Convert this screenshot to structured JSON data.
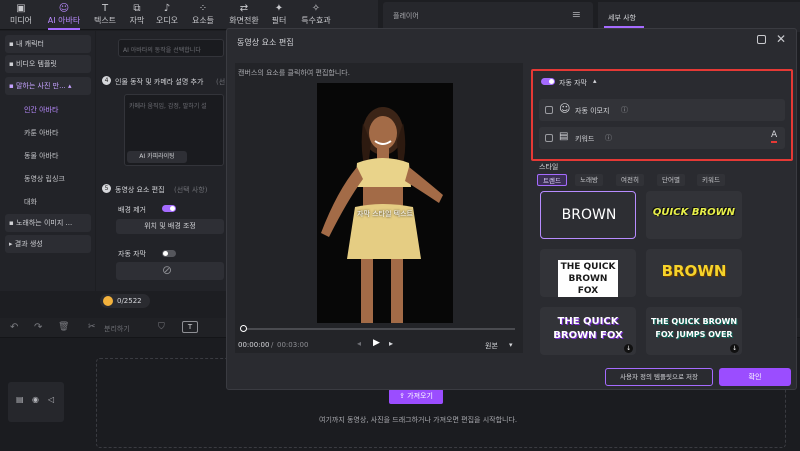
{
  "toolbar": {
    "tabs": [
      {
        "label": "미디어",
        "icon": "media-icon"
      },
      {
        "label": "AI 아바타",
        "icon": "avatar-icon"
      },
      {
        "label": "텍스트",
        "icon": "text-icon"
      },
      {
        "label": "자막",
        "icon": "subtitle-icon"
      },
      {
        "label": "오디오",
        "icon": "audio-icon"
      },
      {
        "label": "요소들",
        "icon": "elements-icon"
      },
      {
        "label": "화면전환",
        "icon": "transition-icon"
      },
      {
        "label": "필터",
        "icon": "filter-icon"
      },
      {
        "label": "특수효과",
        "icon": "effects-icon"
      }
    ],
    "active_index": 1
  },
  "player_panel": {
    "label": "플레이어"
  },
  "detail_panel": {
    "tab_label": "세부 사항"
  },
  "left_nav": {
    "items": [
      {
        "label": "내 캐릭터",
        "kind": "card"
      },
      {
        "label": "비디오 템플릿",
        "kind": "card"
      },
      {
        "label": "말하는 사진 만...",
        "kind": "card",
        "selected": true
      },
      {
        "label": "인간 아바타",
        "kind": "sub",
        "selected": true
      },
      {
        "label": "카툰 아바타",
        "kind": "sub"
      },
      {
        "label": "동물 아바타",
        "kind": "sub"
      },
      {
        "label": "동영상 립싱크",
        "kind": "sub"
      },
      {
        "label": "대화",
        "kind": "sub"
      },
      {
        "label": "노래하는 이미지 ...",
        "kind": "card"
      },
      {
        "label": "결과 생성",
        "kind": "card"
      }
    ]
  },
  "settings": {
    "emotion_placeholder": "AI 아바타의 동작을 선택합니다",
    "step4_label": "인물 동작 및 카메라 설명 추가",
    "step4_suffix": "(선",
    "camera_placeholder": "카메라 움직임, 감정, 말하기 설",
    "copywriting_button": "AI 카피라이팅",
    "step5_label": "동영상 요소 편집",
    "step5_suffix": "(선택 사항)",
    "bg_remove_label": "배경 제거",
    "position_button": "위치 및 배경 조정",
    "auto_caption_label": "자동 자막",
    "credits": "0/2522"
  },
  "dialog": {
    "title": "동영상 요소 편집",
    "canvas_hint": "캔버스의 요소를 클릭하여 편집합니다.",
    "video_caption": "자막 스타일 텍스트",
    "time_current": "00:00:00",
    "time_separator": "/",
    "time_total": "00:03:00",
    "ratio_label": "원본",
    "auto_caption": {
      "label": "자동 자막",
      "enabled": true,
      "options": [
        {
          "label": "자동 이모지",
          "checked": false
        },
        {
          "label": "키워드",
          "checked": false
        }
      ]
    },
    "style_section_label": "스타일",
    "style_tabs": [
      "트렌드",
      "노래방",
      "여전히",
      "단어별",
      "키워드"
    ],
    "style_tab_selected": 0,
    "style_previews": [
      {
        "text": "BROWN",
        "selected": true
      },
      {
        "text": "QUICK BROWN"
      },
      {
        "text": "THE QUICK BROWN FOX"
      },
      {
        "text": "BROWN"
      },
      {
        "text": "THE QUICK BROWN FOX"
      },
      {
        "text": "THE QUICK BROWN FOX JUMPS OVER"
      }
    ],
    "save_template_button": "사용자 정의 템플릿으로 저장",
    "confirm_button": "확인",
    "highlight_color": "#e53935",
    "accent_color": "#a56bff"
  },
  "timeline": {
    "import_button": "가져오기",
    "hint": "여기까지 동영상, 사진을 드래그하거나 가져오면 편집을 시작합니다.",
    "split_label": "분리하기"
  }
}
